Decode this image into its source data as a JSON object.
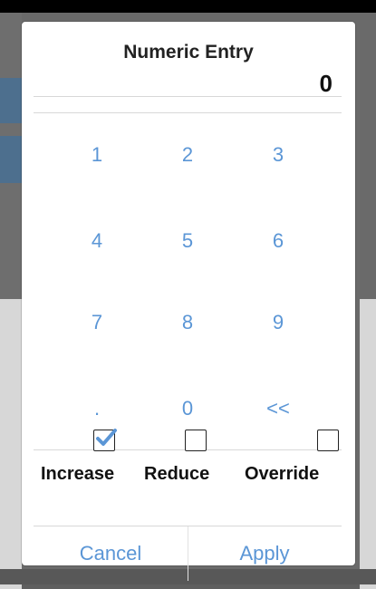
{
  "dialog": {
    "title": "Numeric Entry",
    "display_value": "0"
  },
  "keypad": {
    "keys": [
      "1",
      "2",
      "3",
      "4",
      "5",
      "6",
      "7",
      "8",
      "9",
      ".",
      "0",
      "<<"
    ]
  },
  "options": {
    "increase": {
      "label": "Increase",
      "checked": true
    },
    "reduce": {
      "label": "Reduce",
      "checked": false
    },
    "override": {
      "label": "Override",
      "checked": false
    }
  },
  "footer": {
    "cancel_label": "Cancel",
    "apply_label": "Apply"
  },
  "colors": {
    "accent": "#5b96d6",
    "text": "#111111",
    "divider": "#d8d8d8"
  }
}
